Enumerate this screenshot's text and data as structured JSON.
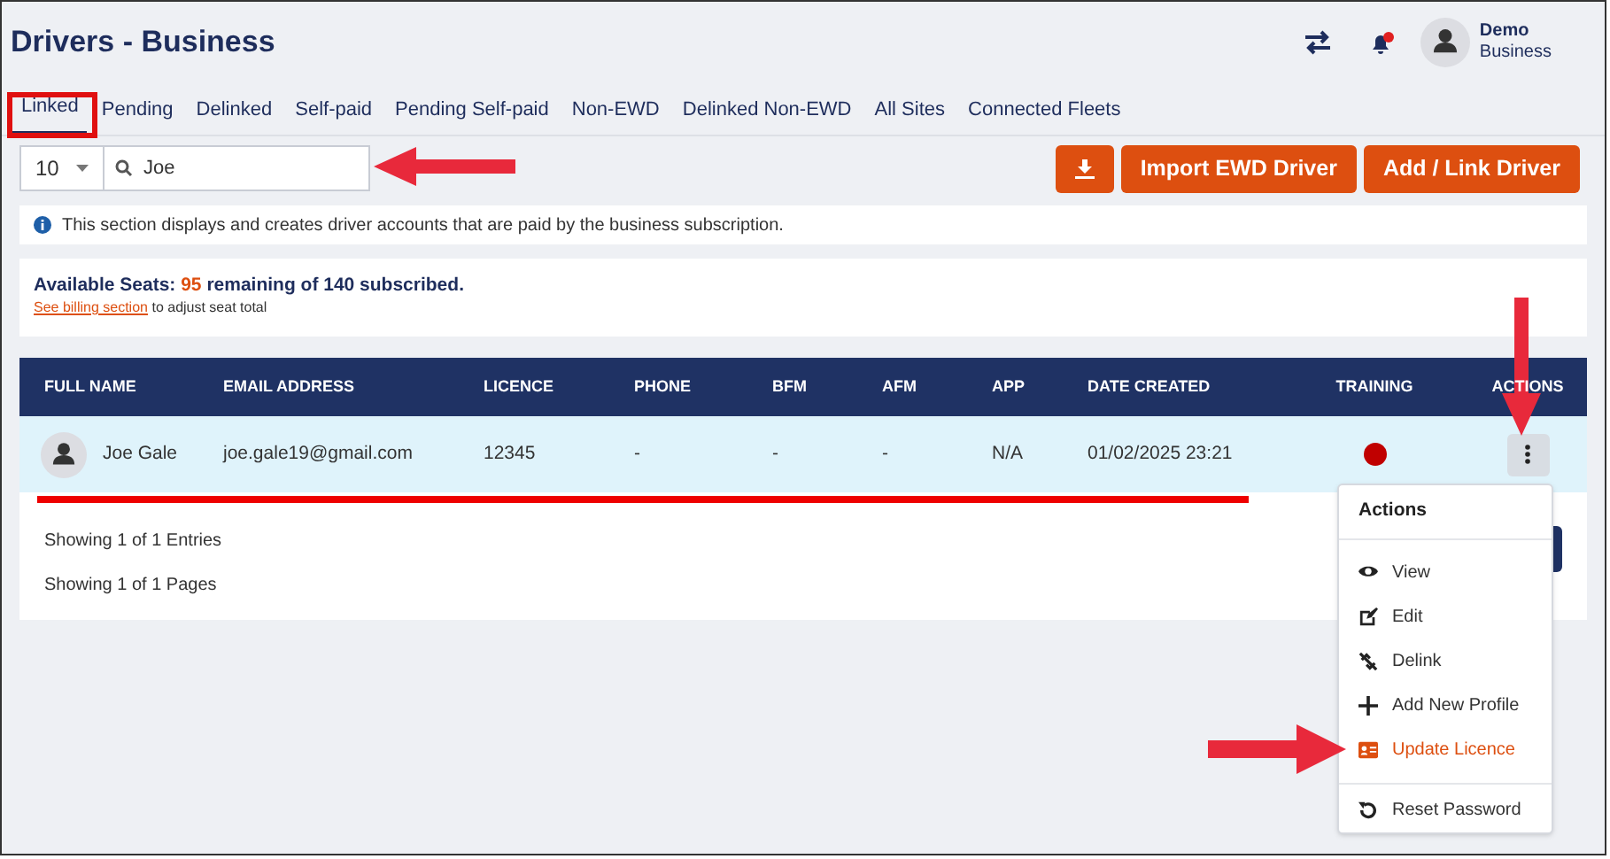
{
  "header": {
    "title": "Drivers - Business",
    "user": {
      "name": "Demo",
      "role": "Business"
    },
    "notification_dot": true
  },
  "tabs": [
    {
      "label": "Linked",
      "selected": true
    },
    {
      "label": "Pending",
      "selected": false
    },
    {
      "label": "Delinked",
      "selected": false
    },
    {
      "label": "Self-paid",
      "selected": false
    },
    {
      "label": "Pending Self-paid",
      "selected": false
    },
    {
      "label": "Non-EWD",
      "selected": false
    },
    {
      "label": "Delinked Non-EWD",
      "selected": false
    },
    {
      "label": "All Sites",
      "selected": false
    },
    {
      "label": "Connected Fleets",
      "selected": false
    }
  ],
  "toolbar": {
    "page_size": "10",
    "search": "Joe",
    "buttons": [
      "Import EWD Driver",
      "Add / Link Driver"
    ]
  },
  "info": "This section displays and creates driver accounts that are paid by the business subscription.",
  "seats": {
    "text": "**Available Seats:** **95** **remaining of 140 subscribed.**",
    "link": "See billing section",
    "suffix": "to adjust seat total"
  },
  "table": {
    "columns": [
      "FULL NAME",
      "EMAIL ADDRESS",
      "LICENCE",
      "PHONE",
      "BFM",
      "AFM",
      "APP",
      "DATE CREATED",
      "TRAINING",
      "ACTIONS"
    ],
    "rows": [
      {
        "cells": [
          "Joe Gale",
          "joe.gale19@gmail.com",
          "12345",
          "-",
          "-",
          "-",
          "N/A",
          "01/02/2025 23:21"
        ],
        "training": {
          "color": "#c00000"
        },
        "selected": true
      }
    ]
  },
  "footer": [
    "Showing 1 of 1 Entries",
    "Showing 1 of 1 Pages"
  ],
  "menu": {
    "title": "Actions",
    "items": [
      {
        "label": "View",
        "kind": "view",
        "highlighted": false
      },
      {
        "label": "Edit",
        "kind": "edit",
        "highlighted": false
      },
      {
        "label": "Delink",
        "kind": "delink",
        "highlighted": false
      },
      {
        "label": "Add New Profile",
        "kind": "add",
        "highlighted": false
      },
      {
        "label": "Update Licence",
        "kind": "licence",
        "highlighted": true
      },
      {
        "label": "Reset Password",
        "kind": "reset",
        "highlighted": false
      }
    ]
  }
}
